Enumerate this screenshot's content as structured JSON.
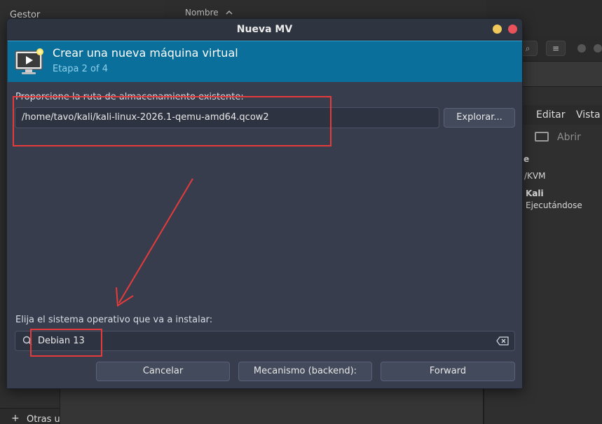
{
  "background": {
    "left_top_text": "Gestor",
    "left_bottom_label": "Otras u",
    "column_header": "Nombre",
    "column_sort_icon": "chevron-up-icon",
    "right_menu": [
      "Editar",
      "Vista"
    ],
    "open_label": "Abrir",
    "fragments": {
      "conn_type": "/KVM",
      "vm_name": "Kali",
      "vm_state": "Ejecutándose",
      "cut_letter": "e"
    }
  },
  "dialog": {
    "title": "Nueva MV",
    "banner": {
      "title": "Crear una nueva máquina virtual",
      "step": "Etapa 2 of 4",
      "icon": "monitor-play-icon"
    },
    "storage_label": "Proporcione la ruta de almacenamiento existente:",
    "storage_path": "/home/tavo/kali/kali-linux-2026.1-qemu-amd64.qcow2",
    "browse_label": "Explorar...",
    "os_label": "Elija el sistema operativo que va a instalar:",
    "os_search_value": "Debian 13",
    "buttons": {
      "cancel": "Cancelar",
      "backend": "Mecanismo (backend):",
      "forward": "Forward"
    }
  },
  "colors": {
    "banner": "#0a6f9a",
    "dialog_bg": "#373d4c",
    "annotation": "#e53b3b",
    "min_button": "#f0c95a",
    "close_button": "#e9525b"
  }
}
